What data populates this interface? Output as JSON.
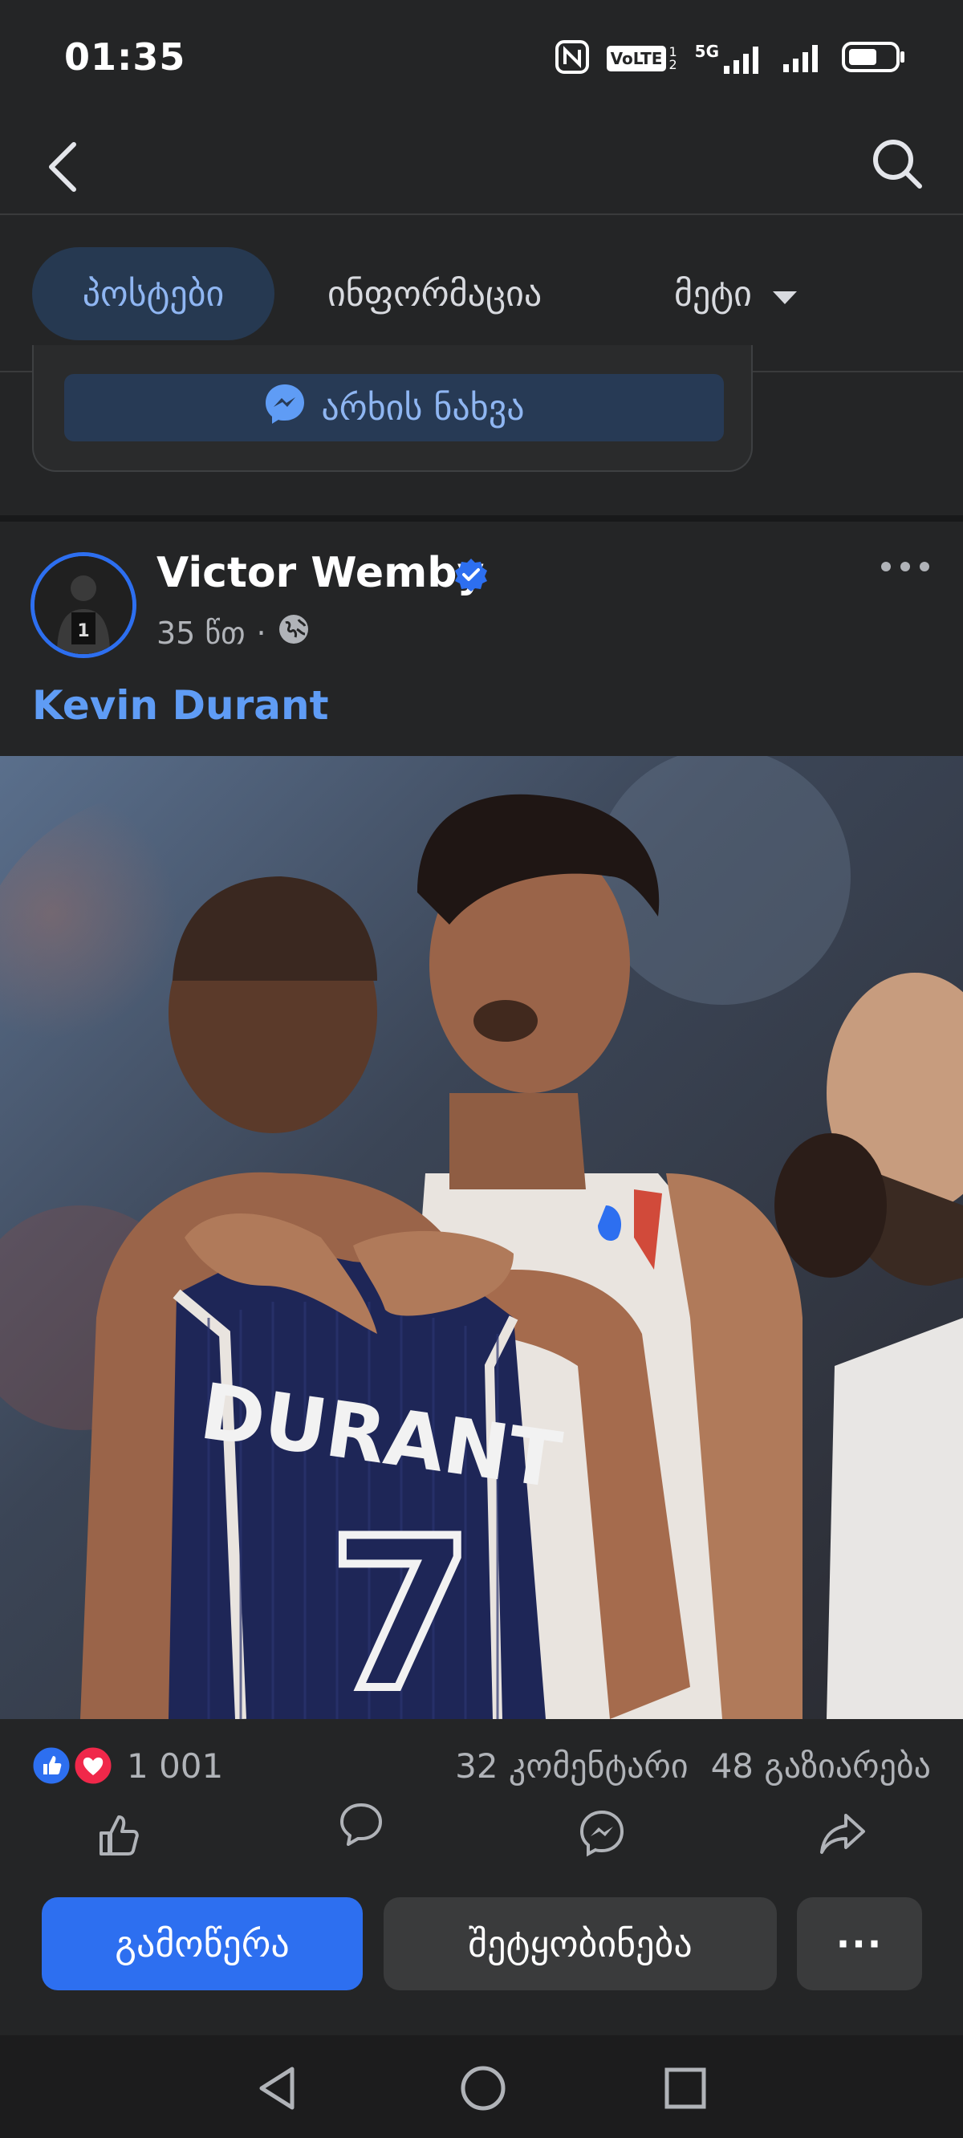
{
  "status_bar": {
    "time": "01:35",
    "network_label": "5G",
    "volte_label": "VoLTE"
  },
  "app_bar": {
    "back_icon": "back-arrow-icon",
    "search_icon": "search-icon"
  },
  "tabs": [
    {
      "label": "პოსტები",
      "active": true
    },
    {
      "label": "ინფორმაცია",
      "active": false
    },
    {
      "label": "მეტი",
      "active": false
    }
  ],
  "messenger_card": {
    "button_label": "არხის ნახვა",
    "icon": "messenger-icon"
  },
  "post": {
    "author": "Victor Wemby",
    "verified": true,
    "time": "35 წთ",
    "audience_icon": "globe-icon",
    "text": "Kevin Durant",
    "reactions_count": "1 001",
    "comments": "32 კომენტარი",
    "shares": "48 გაზიარება",
    "jersey_name": "DURANT",
    "jersey_number": "7"
  },
  "actions": {
    "like_icon": "thumbs-up-icon",
    "comment_icon": "comment-icon",
    "messenger_icon": "messenger-icon",
    "share_icon": "share-icon"
  },
  "bottom_buttons": {
    "follow": "გამოწერა",
    "message": "შეტყობინება",
    "more": "···"
  },
  "colors": {
    "accent": "#2d6ff0",
    "link": "#5f9cf5",
    "background": "#242526",
    "like": "#2d6ff0",
    "love": "#f0284a"
  }
}
